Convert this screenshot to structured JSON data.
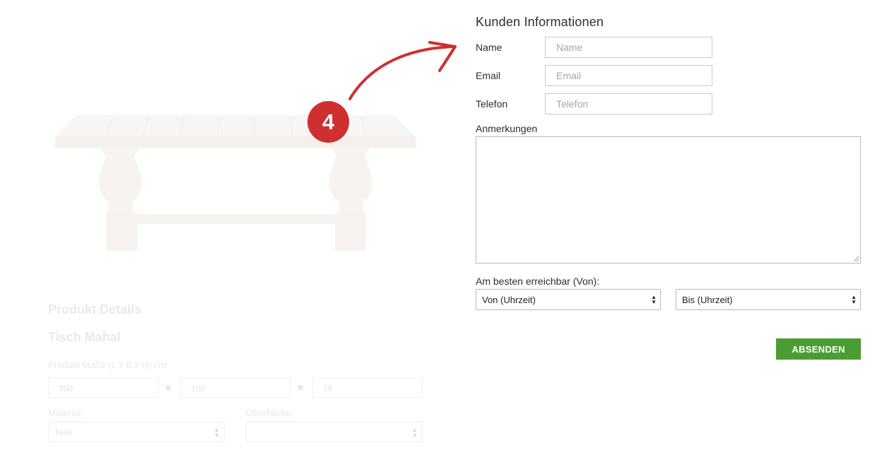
{
  "product": {
    "details_heading": "Produkt Details",
    "name": "Tisch Mahal",
    "dims_label": "Produkt Maße (L x B x H) cm:",
    "dims": [
      "200",
      "100",
      "78"
    ],
    "dims_separator": "✖",
    "material_label": "Material:",
    "material_value": "Teak",
    "surface_label": "Oberfläche:",
    "surface_value": ""
  },
  "form": {
    "title": "Kunden Informationen",
    "name_label": "Name",
    "name_placeholder": "Name",
    "email_label": "Email",
    "email_placeholder": "Email",
    "phone_label": "Telefon",
    "phone_placeholder": "Telefon",
    "notes_label": "Anmerkungen",
    "reachable_label": "Am besten erreichbar (Von):",
    "from_select": "Von (Uhrzeit)",
    "to_select": "Bis (Uhrzeit)",
    "submit_label": "ABSENDEN"
  },
  "annotation": {
    "step_number": "4",
    "color": "#d02f2f"
  },
  "colors": {
    "submit": "#4a9d33",
    "text": "#2d2d2d"
  },
  "icons": {
    "select_arrows": "up-down-chevrons-icon",
    "dims_separator": "cross-icon",
    "annotation_arrow": "curved-arrow-icon"
  }
}
